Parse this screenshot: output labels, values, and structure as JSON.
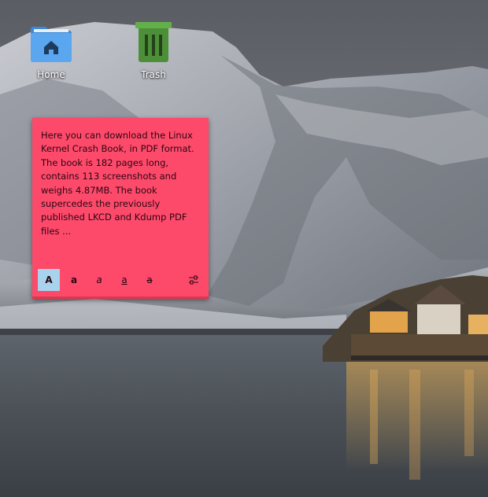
{
  "desktop": {
    "icons": [
      {
        "label": "Home",
        "icon": "folder-home-icon"
      },
      {
        "label": "Trash",
        "icon": "trash-icon"
      }
    ]
  },
  "note": {
    "text": "Here you can download the Linux Kernel Crash Book, in PDF format. The book is 182 pages long, contains 113 screenshots and weighs 4.87MB. The book supercedes the previously published LKCD and Kdump PDF files ...",
    "background_color": "#fd4a6b",
    "toolbar": {
      "normal": "A",
      "bold": "a",
      "italic": "a",
      "underline": "a",
      "strikethrough": "a",
      "active_button_color": "#a8d3ec",
      "settings_icon": "sliders-icon"
    }
  }
}
